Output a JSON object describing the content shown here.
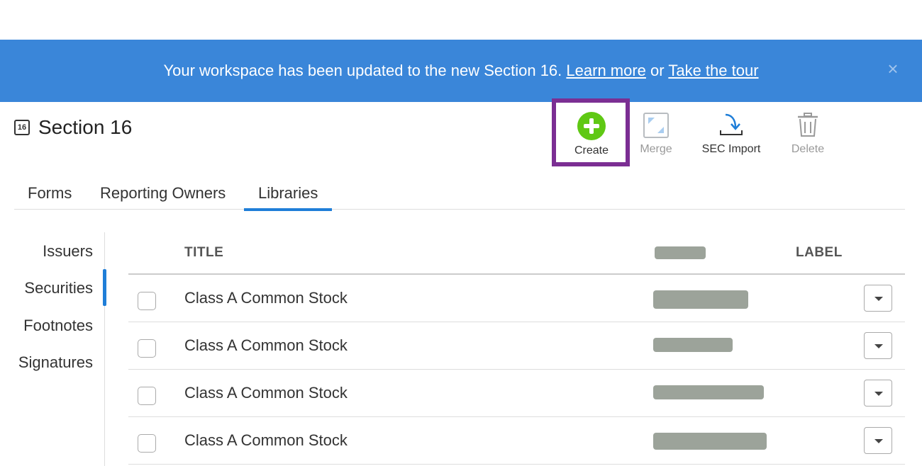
{
  "banner": {
    "message": "Your workspace has been updated to the new Section 16.",
    "learn_more": "Learn more",
    "or_text": "or",
    "tour": "Take the tour",
    "close": "×"
  },
  "header": {
    "icon_text": "16",
    "title": "Section 16"
  },
  "toolbar": {
    "create": "Create",
    "merge": "Merge",
    "sec_import": "SEC Import",
    "delete": "Delete"
  },
  "tabs": [
    {
      "label": "Forms"
    },
    {
      "label": "Reporting Owners"
    },
    {
      "label": "Libraries",
      "active": true
    }
  ],
  "sidebar": {
    "items": [
      {
        "label": "Issuers"
      },
      {
        "label": "Securities",
        "active": true
      },
      {
        "label": "Footnotes"
      },
      {
        "label": "Signatures"
      }
    ]
  },
  "table": {
    "columns": {
      "title": "TITLE",
      "label": "LABEL"
    },
    "rows": [
      {
        "title": "Class A Common Stock"
      },
      {
        "title": "Class A Common Stock"
      },
      {
        "title": "Class A Common Stock"
      },
      {
        "title": "Class A Common Stock"
      }
    ]
  },
  "colors": {
    "banner": "#3a86d9",
    "accent": "#1f7ed8",
    "create_green": "#5fc814",
    "highlight": "#7b2e93",
    "redaction": "#9ca39a"
  }
}
